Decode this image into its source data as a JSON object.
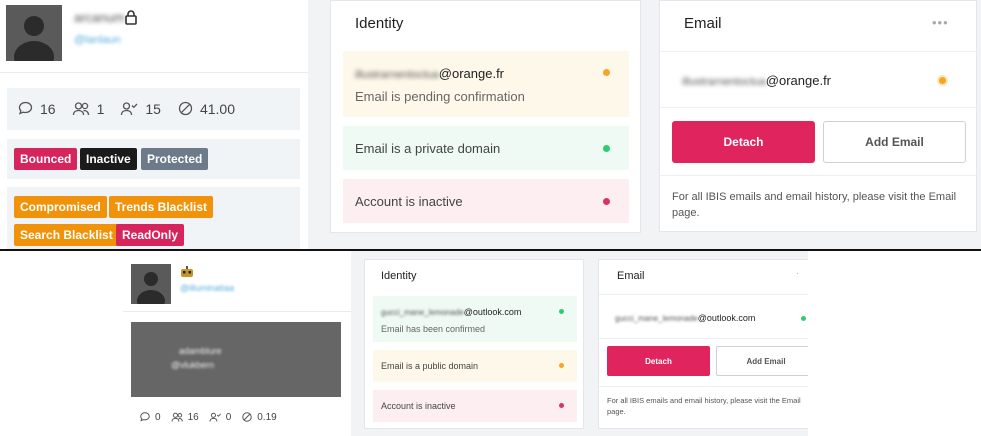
{
  "top": {
    "profile": {
      "name": "arcanum",
      "handle": "@lanlaun",
      "stats": [
        {
          "icon": "comment-icon",
          "value": "16"
        },
        {
          "icon": "users-icon",
          "value": "1"
        },
        {
          "icon": "user-check-icon",
          "value": "15"
        },
        {
          "icon": "ban-icon",
          "value": "41.00"
        }
      ],
      "badges_row1": [
        {
          "label": "Bounced",
          "color": "#d6245c"
        },
        {
          "label": "Inactive",
          "color": "#1b1b1b"
        },
        {
          "label": "Protected",
          "color": "#6c7a89"
        }
      ],
      "badges_row2": [
        {
          "label": "Compromised",
          "color": "#f0930a"
        },
        {
          "label": "Trends Blacklist",
          "color": "#f0930a"
        }
      ],
      "badges_row3": [
        {
          "label": "Search Blacklist",
          "color": "#f0930a"
        },
        {
          "label": "ReadOnly",
          "color": "#d6245c"
        }
      ]
    },
    "identity": {
      "title": "Identity",
      "email_local": "illustrarnentoctua",
      "email_domain": "@orange.fr",
      "email_status": "Email is pending confirmation",
      "domain_status": "Email is a private domain",
      "account_status": "Account is inactive"
    },
    "email": {
      "title": "Email",
      "menu": "•••",
      "email_local": "illustrarnentoctua",
      "email_domain": "@orange.fr",
      "detach_label": "Detach",
      "add_label": "Add Email",
      "footer": "For all IBIS emails and email history, please visit the Email page."
    }
  },
  "bottom": {
    "profile": {
      "handle": "@illuminatiaa",
      "cover_name": "adamblure",
      "cover_handle": "@vlukbern",
      "stats": [
        {
          "icon": "comment-icon",
          "value": "0"
        },
        {
          "icon": "users-icon",
          "value": "16"
        },
        {
          "icon": "user-check-icon",
          "value": "0"
        },
        {
          "icon": "ban-icon",
          "value": "0.19"
        }
      ]
    },
    "identity": {
      "title": "Identity",
      "email_local": "gucci_mane_lemonade",
      "email_domain": "@outlook.com",
      "email_status": "Email has been confirmed",
      "domain_status": "Email is a public domain",
      "account_status": "Account is inactive"
    },
    "email": {
      "title": "Email",
      "email_local": "gucci_mane_lemonade",
      "email_domain": "@outlook.com",
      "detach_label": "Detach",
      "add_label": "Add Email",
      "footer": "For all IBIS emails and email history, please visit the Email page."
    }
  },
  "colors": {
    "accent": "#e0245e",
    "status_green": "#2ecc71",
    "status_orange": "#f5a623",
    "status_red": "#d6336c",
    "link_blue": "#7ec4e8"
  }
}
